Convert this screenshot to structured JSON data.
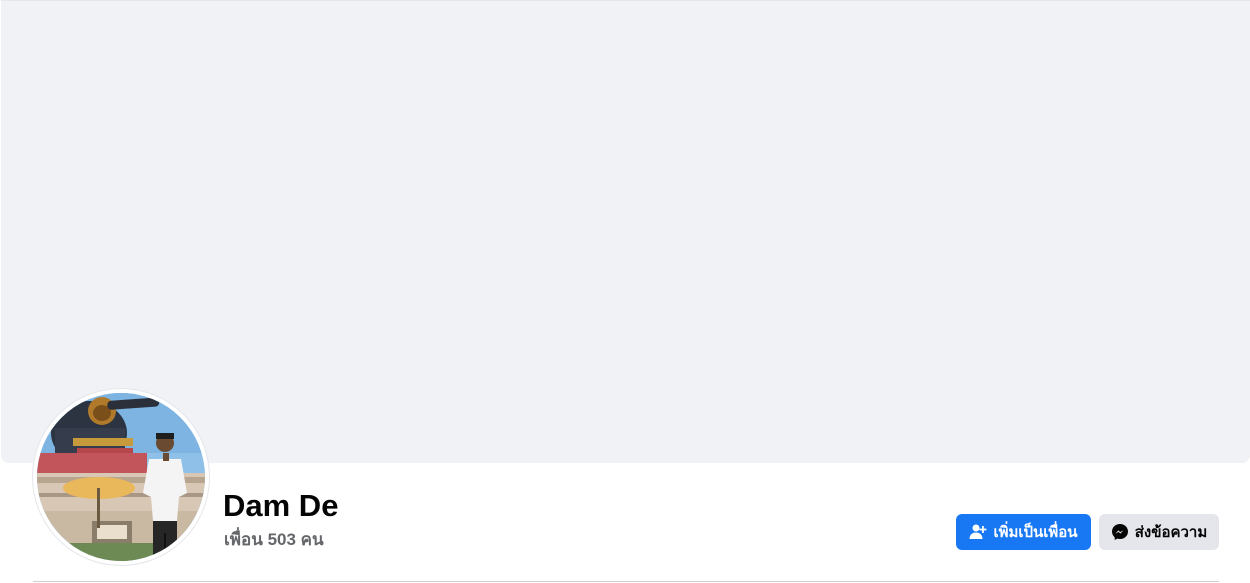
{
  "profile": {
    "name": "Dam De",
    "friends_text": "เพื่อน 503 คน"
  },
  "actions": {
    "add_friend_label": "เพิ่มเป็นเพื่อน",
    "message_label": "ส่งข้อความ"
  },
  "icons": {
    "add_friend": "add-person-icon",
    "message": "messenger-icon"
  },
  "colors": {
    "primary": "#1877f2",
    "cover_bg": "#f0f2f5",
    "secondary_button_bg": "#e4e6eb",
    "name_text": "#050505",
    "muted_text": "#65676b"
  }
}
